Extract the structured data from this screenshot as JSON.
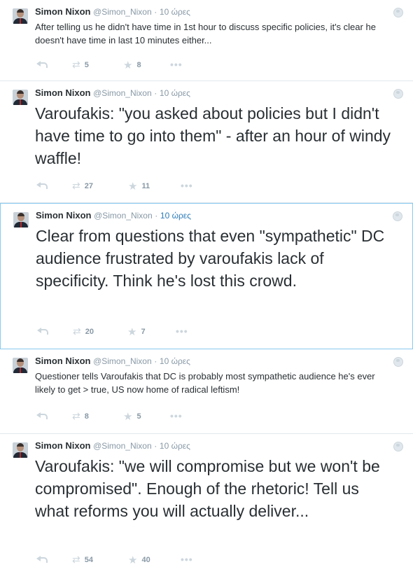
{
  "tweets": [
    {
      "name": "Simon Nixon",
      "handle": "@Simon_Nixon",
      "separator": "·",
      "time": "10 ώρες",
      "text": "After telling us he didn't have time in 1st hour to discuss specific policies, it's clear he doesn't have time in last 10 minutes either...",
      "retweets": "5",
      "favorites": "8",
      "reply_icon": "reply-icon",
      "retweet_icon": "retweet-icon",
      "favorite_icon": "star-icon",
      "more_icon": "more-icon",
      "globe_icon": "globe-icon"
    },
    {
      "name": "Simon Nixon",
      "handle": "@Simon_Nixon",
      "separator": "·",
      "time": "10 ώρες",
      "text": "Varoufakis: \"you asked about policies but I didn't have time to go into them\" - after an hour of windy waffle!",
      "retweets": "27",
      "favorites": "11"
    },
    {
      "name": "Simon Nixon",
      "handle": "@Simon_Nixon",
      "separator": "·",
      "time": "10 ώρες",
      "text": "Clear from questions that even \"sympathetic\" DC audience frustrated by varoufakis lack of specificity. Think he's lost this crowd.",
      "retweets": "20",
      "favorites": "7"
    },
    {
      "name": "Simon Nixon",
      "handle": "@Simon_Nixon",
      "separator": "·",
      "time": "10 ώρες",
      "text": "Questioner tells Varoufakis that DC is probably most sympathetic audience he's ever likely to get > true, US now home of radical leftism!",
      "retweets": "8",
      "favorites": "5"
    },
    {
      "name": "Simon Nixon",
      "handle": "@Simon_Nixon",
      "separator": "·",
      "time": "10 ώρες",
      "text": "Varoufakis: \"we will compromise but we won't be compromised\". Enough of the rhetoric! Tell us what reforms you will actually deliver...",
      "retweets": "54",
      "favorites": "40"
    }
  ],
  "colors": {
    "accent": "#2b7bb9",
    "highlight_border": "#88c9f0",
    "muted": "#8899a6",
    "icon": "#ccd6dd",
    "text": "#292f33"
  }
}
